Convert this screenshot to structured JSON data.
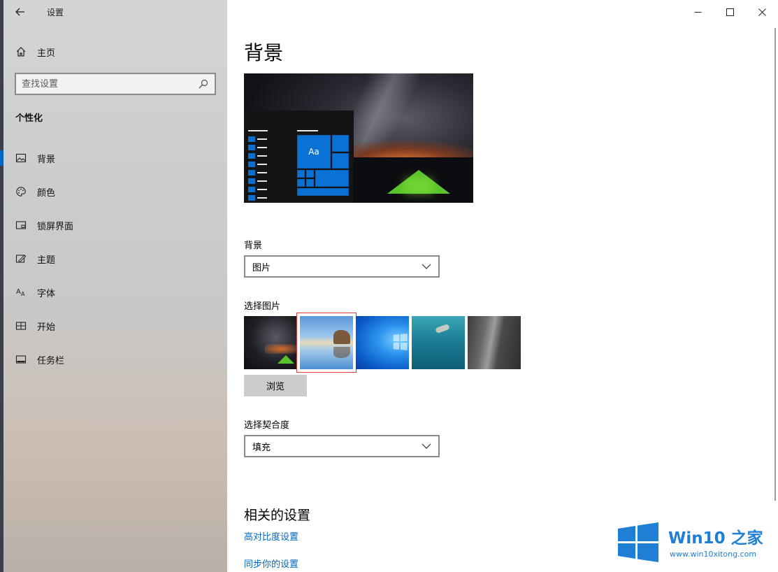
{
  "window": {
    "app_title": "设置",
    "controls": [
      "minimize",
      "maximize",
      "close"
    ]
  },
  "sidebar": {
    "home_label": "主页",
    "search_placeholder": "查找设置",
    "section_title": "个性化",
    "items": [
      {
        "label": "背景",
        "icon": "picture-icon",
        "active": true
      },
      {
        "label": "颜色",
        "icon": "palette-icon",
        "active": false
      },
      {
        "label": "锁屏界面",
        "icon": "lock-screen-icon",
        "active": false
      },
      {
        "label": "主题",
        "icon": "theme-icon",
        "active": false
      },
      {
        "label": "字体",
        "icon": "font-icon",
        "active": false
      },
      {
        "label": "开始",
        "icon": "start-icon",
        "active": false
      },
      {
        "label": "任务栏",
        "icon": "taskbar-icon",
        "active": false
      }
    ]
  },
  "main": {
    "page_title": "背景",
    "preview_tile_text": "Aa",
    "background_label": "背景",
    "background_value": "图片",
    "choose_picture_label": "选择图片",
    "thumbnails": [
      {
        "name": "night-sky-tent",
        "selected": false
      },
      {
        "name": "beach-rocks",
        "selected": true
      },
      {
        "name": "windows-blue",
        "selected": false
      },
      {
        "name": "underwater-swimmer",
        "selected": false
      },
      {
        "name": "rock-waterfall",
        "selected": false
      }
    ],
    "browse_button": "浏览",
    "fit_label": "选择契合度",
    "fit_value": "填充",
    "related_title": "相关的设置",
    "links": [
      "高对比度设置",
      "同步你的设置"
    ]
  },
  "watermark": {
    "brand": "Win10 之家",
    "url": "www.win10xitong.com"
  },
  "colors": {
    "accent": "#0067c0",
    "selection_border": "#e53a3a",
    "tile_blue": "#0a72d4"
  }
}
